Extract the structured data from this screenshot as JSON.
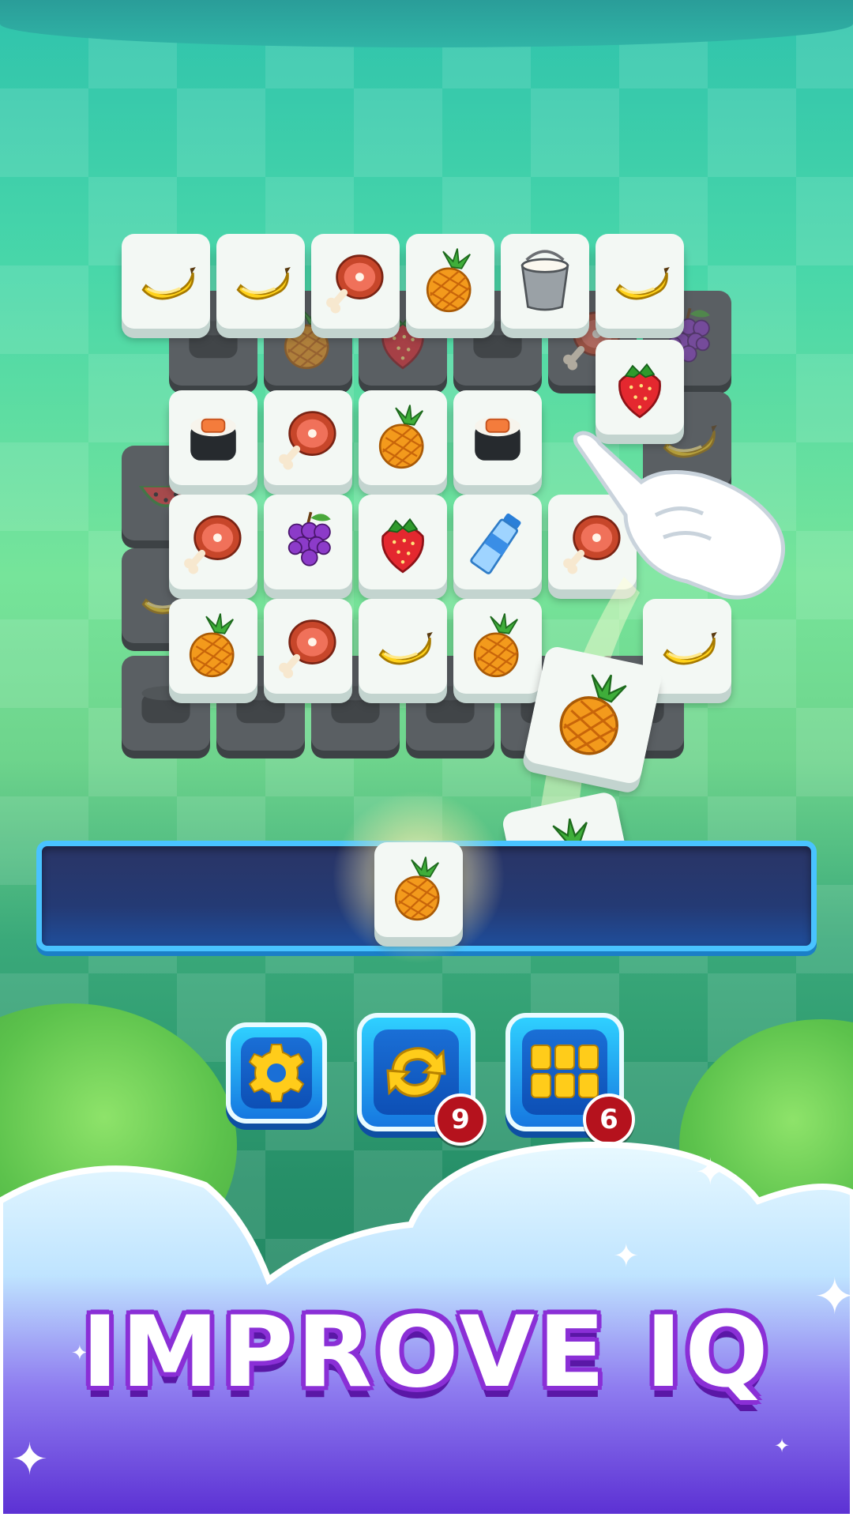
{
  "game": {
    "headline": "IMPROVE IQ",
    "booster_badges": {
      "shuffle": "9",
      "hint": "6"
    }
  },
  "icons": {
    "settings": "gear-icon",
    "shuffle": "shuffle-arrows-icon",
    "hint": "tiles-grid-icon"
  },
  "tiles": {
    "front_rows": [
      [
        "banana",
        "banana",
        "ham",
        "pineapple",
        "milk-bucket",
        "banana"
      ],
      [
        "sushi",
        "ham",
        "pineapple",
        "sushi"
      ],
      [
        "ham",
        "grapes",
        "strawberry",
        "water-bottle",
        "ham"
      ],
      [
        "pineapple",
        "ham",
        "banana",
        "pineapple",
        "banana"
      ]
    ],
    "floating": [
      "strawberry",
      "pineapple",
      "pineapple"
    ],
    "tray": [
      "pineapple"
    ]
  },
  "colors": {
    "tray_border": "#49c3ff",
    "headline_outline": "#8a2fd6",
    "badge": "#b5121d"
  }
}
